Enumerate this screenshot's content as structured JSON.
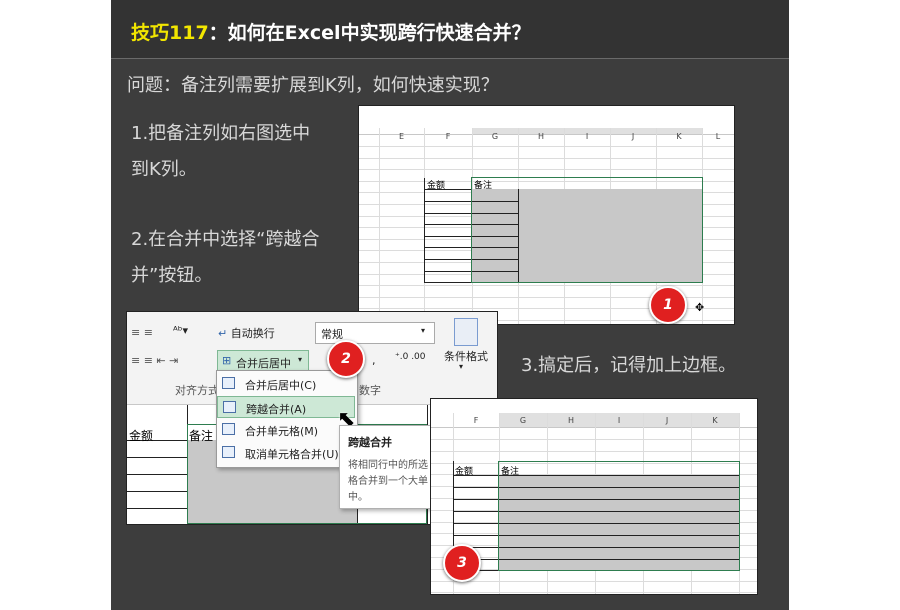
{
  "title": {
    "accent": "技巧117",
    "rest": "：如何在Excel中实现跨行快速合并？"
  },
  "question": "问题：备注列需要扩展到K列，如何快速实现？",
  "steps": {
    "s1_line1": "1.把备注列如右图选中",
    "s1_line2": "到K列。",
    "s2_line1": "2.在合并中选择“跨越合",
    "s2_line2": "并”按钮。",
    "s3": "3.搞定后，记得加上边框。"
  },
  "shot1": {
    "columns": [
      "E",
      "F",
      "G",
      "H",
      "I",
      "J",
      "K",
      "L"
    ],
    "header_amount": "金额",
    "header_note": "备注",
    "badge": "1"
  },
  "shot2": {
    "wrap_text": "自动换行",
    "number_format": "常规",
    "merge_center": "合并后居中",
    "conditional_format": "条件格式",
    "group_align": "对齐方式",
    "group_number": "数字",
    "menu_items": [
      "合并后居中(C)",
      "跨越合并(A)",
      "合并单元格(M)",
      "取消单元格合并(U)"
    ],
    "tooltip_title": "跨越合并",
    "tooltip_body": [
      "将相同行中的所选",
      "格合并到一个大单",
      "中。"
    ],
    "header_amount": "金额",
    "header_note": "备注",
    "badge": "2"
  },
  "shot3": {
    "columns": [
      "F",
      "G",
      "H",
      "I",
      "J",
      "K"
    ],
    "header_amount": "金额",
    "header_note": "备注",
    "badge": "3"
  },
  "colors": {
    "panel": "#3d3d3d",
    "accent": "#f2e600",
    "badge": "#e02020",
    "selection": "#2e7d4f"
  }
}
